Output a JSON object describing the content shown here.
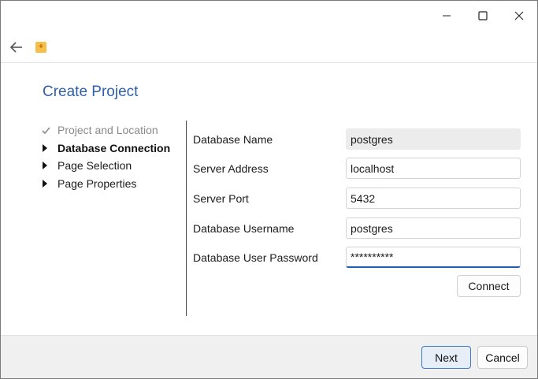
{
  "window": {
    "title": "Create Project"
  },
  "steps": [
    {
      "label": "Project and Location",
      "state": "done"
    },
    {
      "label": "Database Connection",
      "state": "active"
    },
    {
      "label": "Page Selection",
      "state": "pending"
    },
    {
      "label": "Page Properties",
      "state": "pending"
    }
  ],
  "form": {
    "db_name": {
      "label": "Database Name",
      "value": "postgres"
    },
    "server_address": {
      "label": "Server Address",
      "value": "localhost"
    },
    "server_port": {
      "label": "Server Port",
      "value": "5432"
    },
    "db_username": {
      "label": "Database Username",
      "value": "postgres"
    },
    "db_password": {
      "label": "Database User Password",
      "value": "**********"
    }
  },
  "buttons": {
    "connect": "Connect",
    "next": "Next",
    "cancel": "Cancel"
  },
  "colors": {
    "title": "#2e5fa8",
    "accent": "#1f5fb3"
  }
}
